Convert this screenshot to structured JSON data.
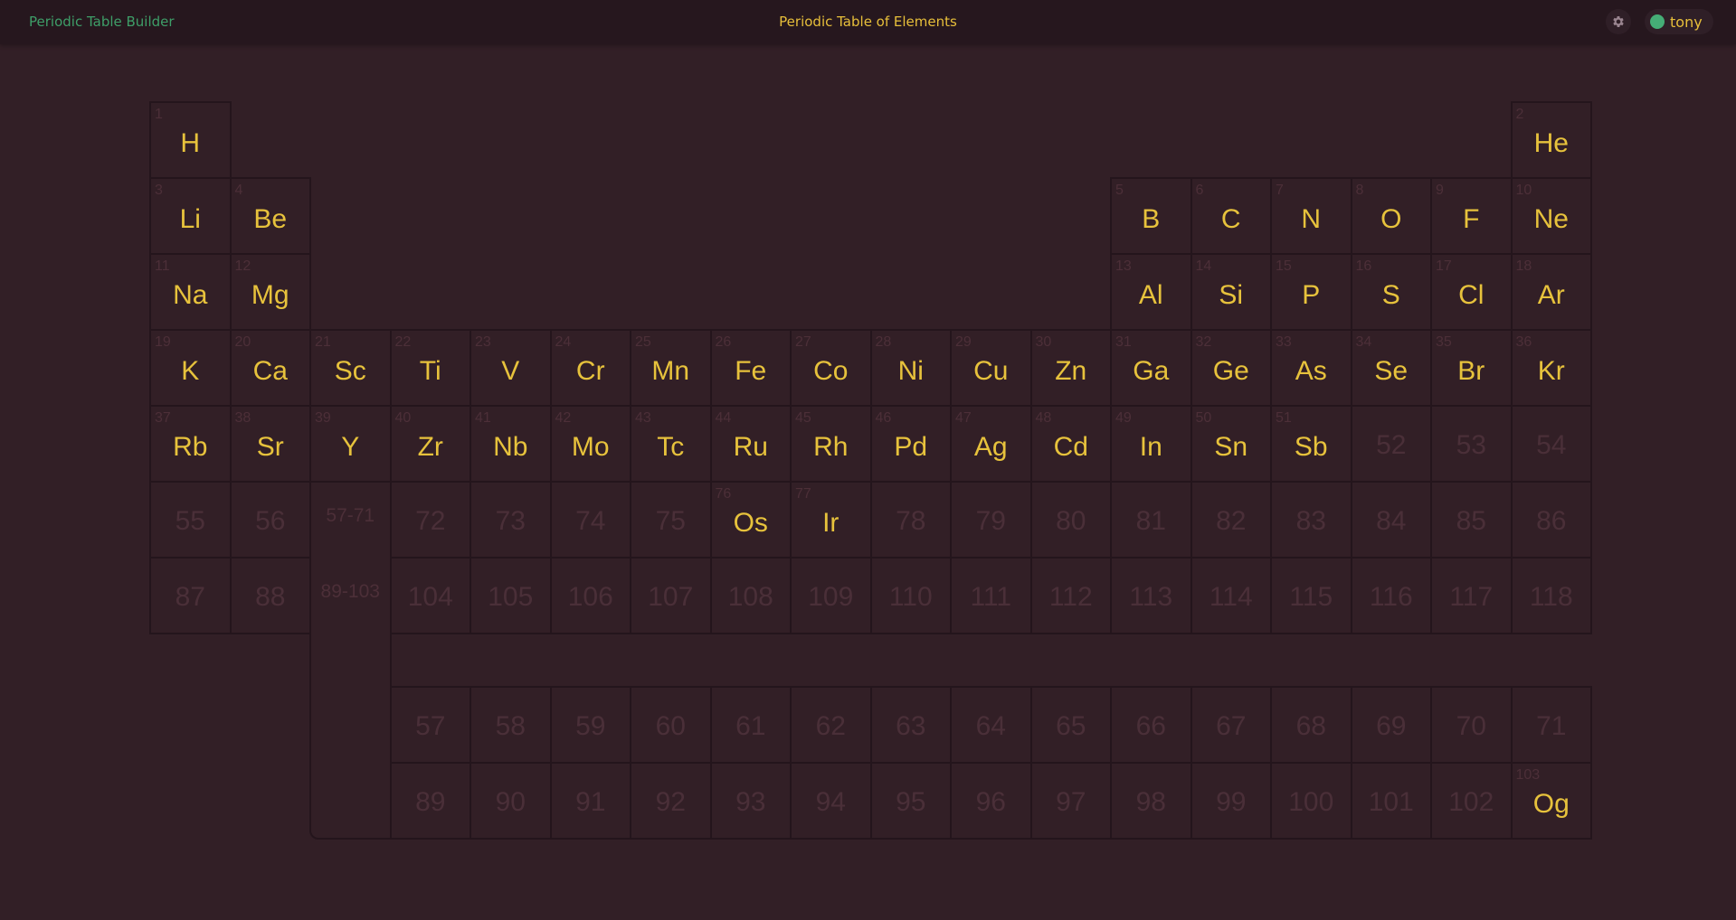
{
  "header": {
    "app_title": "Periodic Table Builder",
    "page_title": "Periodic Table of Elements",
    "settings_icon": "gear-icon",
    "user": {
      "name": "tony",
      "status_color": "#45ad76"
    }
  },
  "colors": {
    "symbol": "#e7c23c",
    "number": "#4c2f38",
    "background": "#321f26",
    "border": "#24151c"
  },
  "placeholders": {
    "lanthanides": "57-71",
    "actinides": "89-103"
  },
  "main_table": [
    [
      {
        "n": 1,
        "s": "H"
      },
      null,
      null,
      null,
      null,
      null,
      null,
      null,
      null,
      null,
      null,
      null,
      null,
      null,
      null,
      null,
      null,
      {
        "n": 2,
        "s": "He"
      }
    ],
    [
      {
        "n": 3,
        "s": "Li"
      },
      {
        "n": 4,
        "s": "Be"
      },
      null,
      null,
      null,
      null,
      null,
      null,
      null,
      null,
      null,
      null,
      {
        "n": 5,
        "s": "B"
      },
      {
        "n": 6,
        "s": "C"
      },
      {
        "n": 7,
        "s": "N"
      },
      {
        "n": 8,
        "s": "O"
      },
      {
        "n": 9,
        "s": "F"
      },
      {
        "n": 10,
        "s": "Ne"
      }
    ],
    [
      {
        "n": 11,
        "s": "Na"
      },
      {
        "n": 12,
        "s": "Mg"
      },
      null,
      null,
      null,
      null,
      null,
      null,
      null,
      null,
      null,
      null,
      {
        "n": 13,
        "s": "Al"
      },
      {
        "n": 14,
        "s": "Si"
      },
      {
        "n": 15,
        "s": "P"
      },
      {
        "n": 16,
        "s": "S"
      },
      {
        "n": 17,
        "s": "Cl"
      },
      {
        "n": 18,
        "s": "Ar"
      }
    ],
    [
      {
        "n": 19,
        "s": "K"
      },
      {
        "n": 20,
        "s": "Ca"
      },
      {
        "n": 21,
        "s": "Sc"
      },
      {
        "n": 22,
        "s": "Ti"
      },
      {
        "n": 23,
        "s": "V"
      },
      {
        "n": 24,
        "s": "Cr"
      },
      {
        "n": 25,
        "s": "Mn"
      },
      {
        "n": 26,
        "s": "Fe"
      },
      {
        "n": 27,
        "s": "Co"
      },
      {
        "n": 28,
        "s": "Ni"
      },
      {
        "n": 29,
        "s": "Cu"
      },
      {
        "n": 30,
        "s": "Zn"
      },
      {
        "n": 31,
        "s": "Ga"
      },
      {
        "n": 32,
        "s": "Ge"
      },
      {
        "n": 33,
        "s": "As"
      },
      {
        "n": 34,
        "s": "Se"
      },
      {
        "n": 35,
        "s": "Br"
      },
      {
        "n": 36,
        "s": "Kr"
      }
    ],
    [
      {
        "n": 37,
        "s": "Rb"
      },
      {
        "n": 38,
        "s": "Sr"
      },
      {
        "n": 39,
        "s": "Y"
      },
      {
        "n": 40,
        "s": "Zr"
      },
      {
        "n": 41,
        "s": "Nb"
      },
      {
        "n": 42,
        "s": "Mo"
      },
      {
        "n": 43,
        "s": "Tc"
      },
      {
        "n": 44,
        "s": "Ru"
      },
      {
        "n": 45,
        "s": "Rh"
      },
      {
        "n": 46,
        "s": "Pd"
      },
      {
        "n": 47,
        "s": "Ag"
      },
      {
        "n": 48,
        "s": "Cd"
      },
      {
        "n": 49,
        "s": "In"
      },
      {
        "n": 50,
        "s": "Sn"
      },
      {
        "n": 51,
        "s": "Sb"
      },
      {
        "n": 52,
        "s": ""
      },
      {
        "n": 53,
        "s": ""
      },
      {
        "n": 54,
        "s": ""
      }
    ],
    [
      {
        "n": 55,
        "s": ""
      },
      {
        "n": 56,
        "s": ""
      },
      "ph-lanthanides",
      {
        "n": 72,
        "s": ""
      },
      {
        "n": 73,
        "s": ""
      },
      {
        "n": 74,
        "s": ""
      },
      {
        "n": 75,
        "s": ""
      },
      {
        "n": 76,
        "s": "Os"
      },
      {
        "n": 77,
        "s": "Ir"
      },
      {
        "n": 78,
        "s": ""
      },
      {
        "n": 79,
        "s": ""
      },
      {
        "n": 80,
        "s": ""
      },
      {
        "n": 81,
        "s": ""
      },
      {
        "n": 82,
        "s": ""
      },
      {
        "n": 83,
        "s": ""
      },
      {
        "n": 84,
        "s": ""
      },
      {
        "n": 85,
        "s": ""
      },
      {
        "n": 86,
        "s": ""
      }
    ],
    [
      {
        "n": 87,
        "s": ""
      },
      {
        "n": 88,
        "s": ""
      },
      "ph-actinides",
      {
        "n": 104,
        "s": ""
      },
      {
        "n": 105,
        "s": ""
      },
      {
        "n": 106,
        "s": ""
      },
      {
        "n": 107,
        "s": ""
      },
      {
        "n": 108,
        "s": ""
      },
      {
        "n": 109,
        "s": ""
      },
      {
        "n": 110,
        "s": ""
      },
      {
        "n": 111,
        "s": ""
      },
      {
        "n": 112,
        "s": ""
      },
      {
        "n": 113,
        "s": ""
      },
      {
        "n": 114,
        "s": ""
      },
      {
        "n": 115,
        "s": ""
      },
      {
        "n": 116,
        "s": ""
      },
      {
        "n": 117,
        "s": ""
      },
      {
        "n": 118,
        "s": ""
      }
    ]
  ],
  "f_block": [
    [
      {
        "n": 57,
        "s": ""
      },
      {
        "n": 58,
        "s": ""
      },
      {
        "n": 59,
        "s": ""
      },
      {
        "n": 60,
        "s": ""
      },
      {
        "n": 61,
        "s": ""
      },
      {
        "n": 62,
        "s": ""
      },
      {
        "n": 63,
        "s": ""
      },
      {
        "n": 64,
        "s": ""
      },
      {
        "n": 65,
        "s": ""
      },
      {
        "n": 66,
        "s": ""
      },
      {
        "n": 67,
        "s": ""
      },
      {
        "n": 68,
        "s": ""
      },
      {
        "n": 69,
        "s": ""
      },
      {
        "n": 70,
        "s": ""
      },
      {
        "n": 71,
        "s": ""
      }
    ],
    [
      {
        "n": 89,
        "s": ""
      },
      {
        "n": 90,
        "s": ""
      },
      {
        "n": 91,
        "s": ""
      },
      {
        "n": 92,
        "s": ""
      },
      {
        "n": 93,
        "s": ""
      },
      {
        "n": 94,
        "s": ""
      },
      {
        "n": 95,
        "s": ""
      },
      {
        "n": 96,
        "s": ""
      },
      {
        "n": 97,
        "s": ""
      },
      {
        "n": 98,
        "s": ""
      },
      {
        "n": 99,
        "s": ""
      },
      {
        "n": 100,
        "s": ""
      },
      {
        "n": 101,
        "s": ""
      },
      {
        "n": 102,
        "s": ""
      },
      {
        "n": 103,
        "s": "Og"
      }
    ]
  ]
}
